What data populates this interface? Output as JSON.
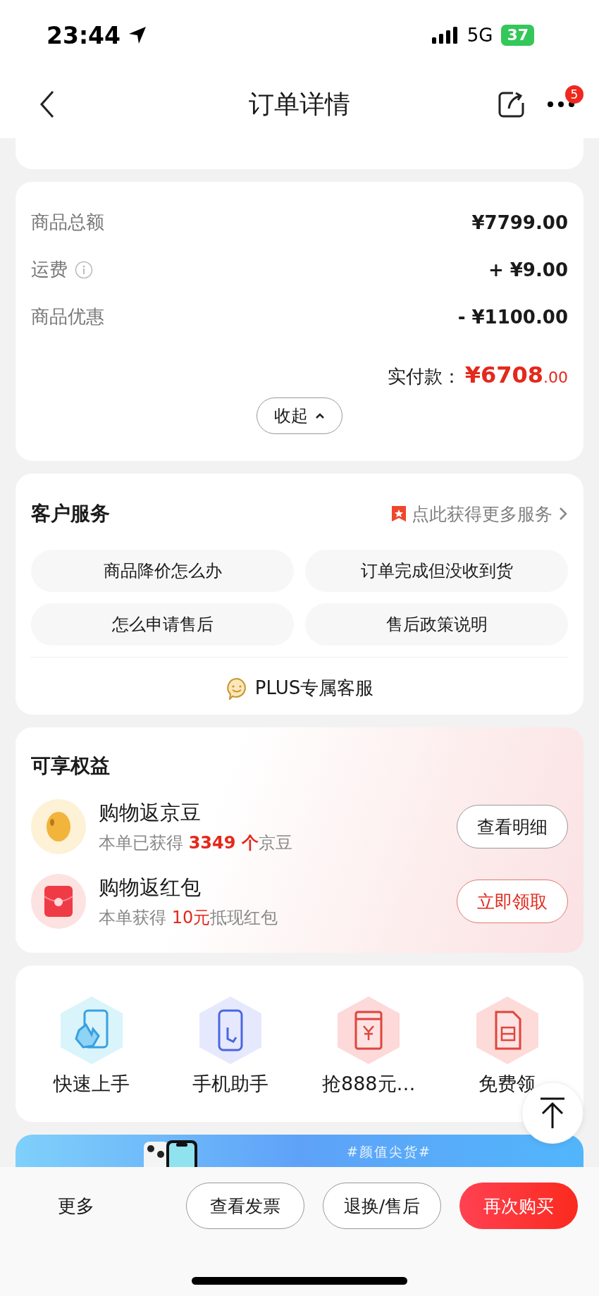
{
  "status_bar": {
    "time": "23:44",
    "network": "5G",
    "battery": "37"
  },
  "nav": {
    "title": "订单详情",
    "badge": "5"
  },
  "price_summary": {
    "rows": [
      {
        "label": "商品总额",
        "value": "¥7799.00",
        "info": false
      },
      {
        "label": "运费",
        "value": "+ ¥9.00",
        "info": true
      },
      {
        "label": "商品优惠",
        "value": "- ¥1100.00",
        "info": false
      }
    ],
    "total_label": "实付款：",
    "total_major": "¥6708",
    "total_minor": ".00",
    "collapse_button": "收起"
  },
  "customer_service": {
    "title": "客户服务",
    "link": "点此获得更多服务",
    "questions": [
      "商品降价怎么办",
      "订单完成但没收到货",
      "怎么申请售后",
      "售后政策说明"
    ],
    "plus_service": "PLUS专属客服"
  },
  "benefits": {
    "title": "可享权益",
    "items": [
      {
        "kind": "bean",
        "title": "购物返京豆",
        "detail_prefix": "本单已获得 ",
        "detail_highlight": "3349 个",
        "detail_suffix": "京豆",
        "button": "查看明细",
        "button_emphasis": false
      },
      {
        "kind": "red_packet",
        "title": "购物返红包",
        "detail_prefix": "本单获得 ",
        "detail_highlight": "10元",
        "detail_suffix": "抵现红包",
        "button": "立即领取",
        "button_emphasis": true
      }
    ]
  },
  "shortcuts": [
    {
      "kind": "tap",
      "label": "快速上手"
    },
    {
      "kind": "phone",
      "label": "手机助手"
    },
    {
      "kind": "red_packet",
      "label": "抢888元…"
    },
    {
      "kind": "sim",
      "label": "免费领"
    }
  ],
  "banner": {
    "tag": "#颜值尖货#"
  },
  "bottom_bar": {
    "more": "更多",
    "buttons": [
      {
        "label": "查看发票",
        "primary": false
      },
      {
        "label": "退换/售后",
        "primary": false
      },
      {
        "label": "再次购买",
        "primary": true
      }
    ]
  }
}
